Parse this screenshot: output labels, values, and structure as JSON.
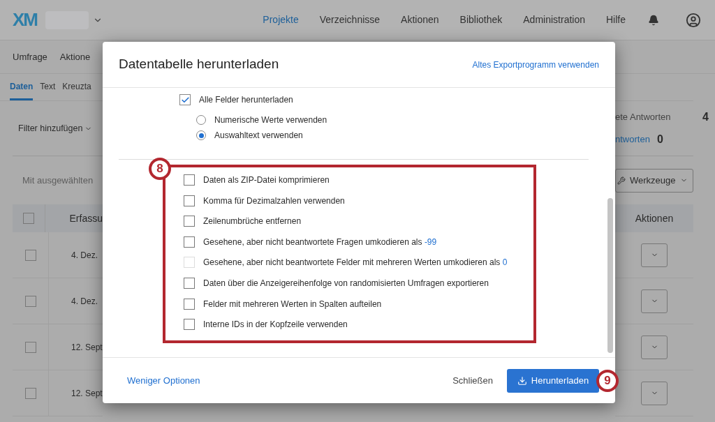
{
  "app_header": {
    "logo": "XM",
    "nav": [
      {
        "label": "Projekte",
        "selected": true
      },
      {
        "label": "Verzeichnisse",
        "selected": false
      },
      {
        "label": "Aktionen",
        "selected": false
      },
      {
        "label": "Bibliothek",
        "selected": false
      },
      {
        "label": "Administration",
        "selected": false
      },
      {
        "label": "Hilfe",
        "selected": false
      }
    ]
  },
  "subnav": [
    "Umfrage",
    "Aktione"
  ],
  "tabs": [
    {
      "label": "Daten",
      "selected": true
    },
    {
      "label": "Text",
      "selected": false
    },
    {
      "label": "Kreuzta",
      "selected": false
    }
  ],
  "filter_button": "Filter hinzufügen",
  "bulk_action": "Mit ausgewählten",
  "stats": [
    {
      "label": "ete Antworten",
      "value": "4",
      "kind": "plain"
    },
    {
      "label": "ntworten",
      "value": "0",
      "kind": "link"
    }
  ],
  "tools_button": "Werkzeuge",
  "table": {
    "header_checked": false,
    "columns": [
      "Erfassu",
      "Aktionen"
    ],
    "rows": [
      {
        "date": "4. Dez.",
        "checked": false
      },
      {
        "date": "4. Dez.",
        "checked": false
      },
      {
        "date": "12. Sept",
        "checked": false
      },
      {
        "date": "12. Sept",
        "checked": false
      }
    ]
  },
  "dialog": {
    "title": "Datentabelle herunterladen",
    "legacy_link": "Altes Exportprogramm verwenden",
    "all_fields": {
      "label": "Alle Felder herunterladen",
      "checked": true
    },
    "format_options": [
      {
        "label": "Numerische Werte verwenden",
        "selected": false
      },
      {
        "label": "Auswahltext verwenden",
        "selected": true
      }
    ],
    "options": [
      {
        "label": "Daten als ZIP-Datei komprimieren",
        "checked": false,
        "disabled": false
      },
      {
        "label": "Komma für Dezimalzahlen verwenden",
        "checked": false,
        "disabled": false
      },
      {
        "label": "Zeilenumbrüche entfernen",
        "checked": false,
        "disabled": false
      },
      {
        "label": "Gesehene, aber nicht beantwortete Fragen umkodieren als",
        "value": "-99",
        "checked": false,
        "disabled": false
      },
      {
        "label": "Gesehene, aber nicht beantwortete Felder mit mehreren Werten umkodieren als",
        "value": "0",
        "checked": false,
        "disabled": true
      },
      {
        "label": "Daten über die Anzeigereihenfolge von randomisierten Umfragen exportieren",
        "checked": false,
        "disabled": false
      },
      {
        "label": "Felder mit mehreren Werten in Spalten aufteilen",
        "checked": false,
        "disabled": false
      },
      {
        "label": "Interne IDs in der Kopfzeile verwenden",
        "checked": false,
        "disabled": false
      }
    ],
    "less_link": "Weniger Optionen",
    "close_button": "Schließen",
    "download_button": "Herunterladen"
  },
  "annotations": [
    {
      "label": "8"
    },
    {
      "label": "9"
    }
  ]
}
